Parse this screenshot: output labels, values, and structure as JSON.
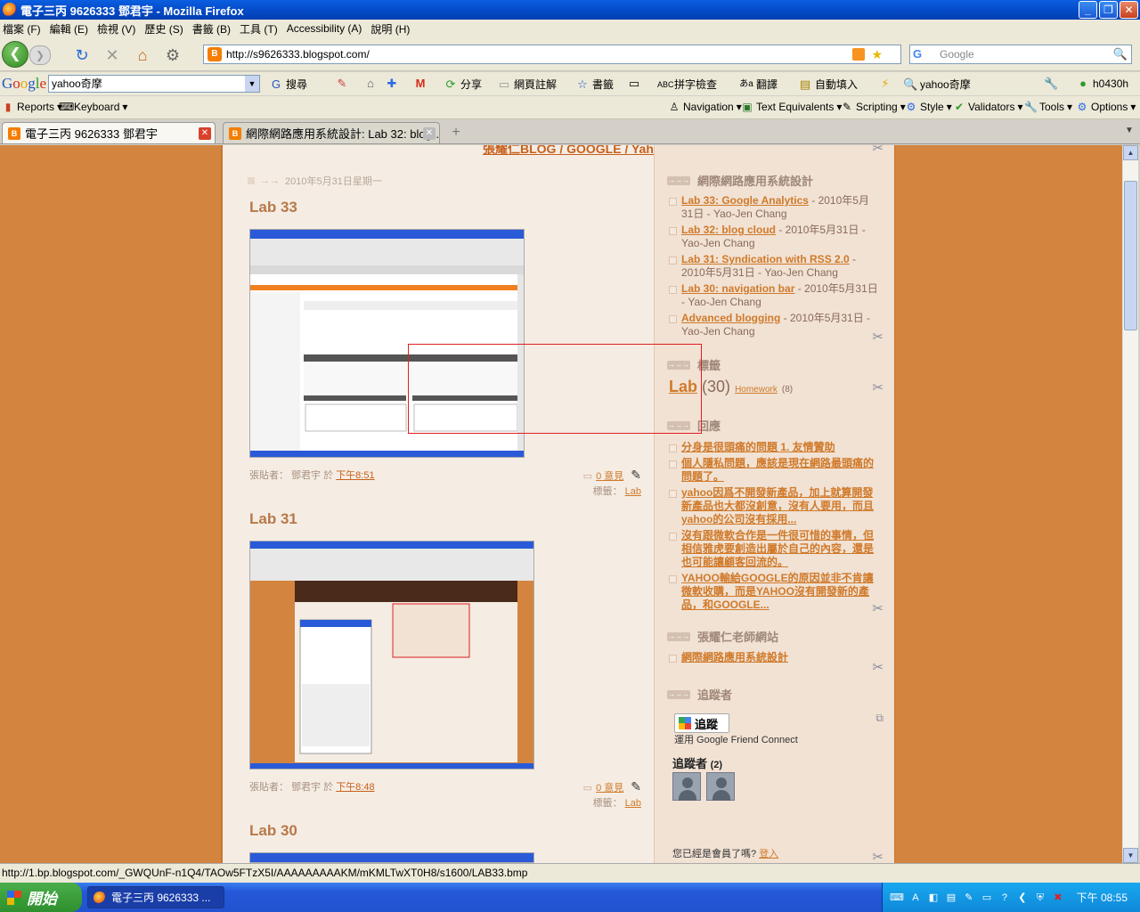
{
  "window": {
    "title": "電子三丙 9626333 鄧君宇 - Mozilla Firefox"
  },
  "menu": [
    "檔案 (F)",
    "編輯 (E)",
    "檢視 (V)",
    "歷史 (S)",
    "書籤 (B)",
    "工具 (T)",
    "Accessibility (A)",
    "說明 (H)"
  ],
  "nav": {
    "url": "http://s9626333.blogspot.com/",
    "search_placeholder": "Google"
  },
  "google_toolbar": {
    "query": "yahoo奇摩",
    "search_label": "搜尋",
    "share_label": "分享",
    "annotate_label": "網頁註解",
    "bookmarks_label": "書籤",
    "spellcheck_label": "拼字檢查",
    "translate_label": "翻譯",
    "autofill_label": "自動填入",
    "yahoo_label": "yahoo奇摩",
    "account_label": "h0430h"
  },
  "bookmarks": {
    "reports": "Reports",
    "keyboard": "Keyboard",
    "navigation": "Navigation",
    "text_eq": "Text Equivalents",
    "scripting": "Scripting",
    "style": "Style",
    "validators": "Validators",
    "tools": "Tools",
    "options": "Options"
  },
  "tabs": [
    {
      "label": "電子三丙 9626333 鄧君宇"
    },
    {
      "label": "網際網路應用系統設計: Lab 32: blog…"
    }
  ],
  "blog": {
    "top_links": "張耀仁BLOG / GOOGLE / Yahoo",
    "date_header": "2010年5月31日星期一",
    "posts": [
      {
        "title": "Lab 33",
        "footer_prefix": "張貼者： 鄧君宇 於",
        "time": "下午8:51",
        "comments": "0 意見",
        "label_prefix": "標籤：",
        "label": "Lab"
      },
      {
        "title": "Lab 31",
        "footer_prefix": "張貼者： 鄧君宇 於",
        "time": "下午8:48",
        "comments": "0 意見",
        "label_prefix": "標籤：",
        "label": "Lab"
      },
      {
        "title": "Lab 30"
      }
    ]
  },
  "sidebar": {
    "w1_title": "網際網路應用系統設計",
    "w1_items": [
      {
        "link": "Lab 33: Google Analytics",
        "rest": " - 2010年5月31日 - Yao-Jen Chang"
      },
      {
        "link": "Lab 32: blog cloud",
        "rest": " - 2010年5月31日 - Yao-Jen Chang"
      },
      {
        "link": "Lab 31: Syndication with RSS 2.0",
        "rest": " - 2010年5月31日 - Yao-Jen Chang"
      },
      {
        "link": "Lab 30: navigation bar",
        "rest": " - 2010年5月31日 - Yao-Jen Chang"
      },
      {
        "link": "Advanced blogging",
        "rest": " - 2010年5月31日 - Yao-Jen Chang"
      }
    ],
    "labels_title": "標籤",
    "label_lab": "Lab",
    "label_lab_count": "(30)",
    "label_hw": "Homework",
    "label_hw_count": "(8)",
    "w3_title": "回應",
    "w3_items": [
      "分身是很頭痛的問題 1. 友情贊助",
      "個人隱私問題，應該是現在網路最頭痛的問題了。",
      "yahoo因爲不開發新產品，加上就算開發新產品也大都沒創意，沒有人要用，而且yahoo的公司沒有採用...",
      "沒有跟微軟合作是一件很可惜的事情，但相信雅虎要創造出屬於自己的內容，還是也可能讓顧客回流的。",
      "YAHOO輸給GOOGLE的原因並非不肯讓微軟收購，而是YAHOO沒有開發新的產品，和GOOGLE..."
    ],
    "w4_title": "張耀仁老師網站",
    "w4_link": "網際網路應用系統設計",
    "w5_title": "追蹤者",
    "follow_btn": "追蹤",
    "gfc_text": "運用 Google Friend Connect",
    "followers_label": "追蹤者",
    "followers_count": "(2)",
    "member_q": "您已經是會員了嗎?",
    "login": "登入"
  },
  "status": {
    "text": "http://1.bp.blogspot.com/_GWQUnF-n1Q4/TAOw5FTzX5I/AAAAAAAAAKM/mKMLTwXT0H8/s1600/LAB33.bmp"
  },
  "taskbar": {
    "start": "開始",
    "item": "電子三丙 9626333 ...",
    "clock": "下午 08:55"
  }
}
